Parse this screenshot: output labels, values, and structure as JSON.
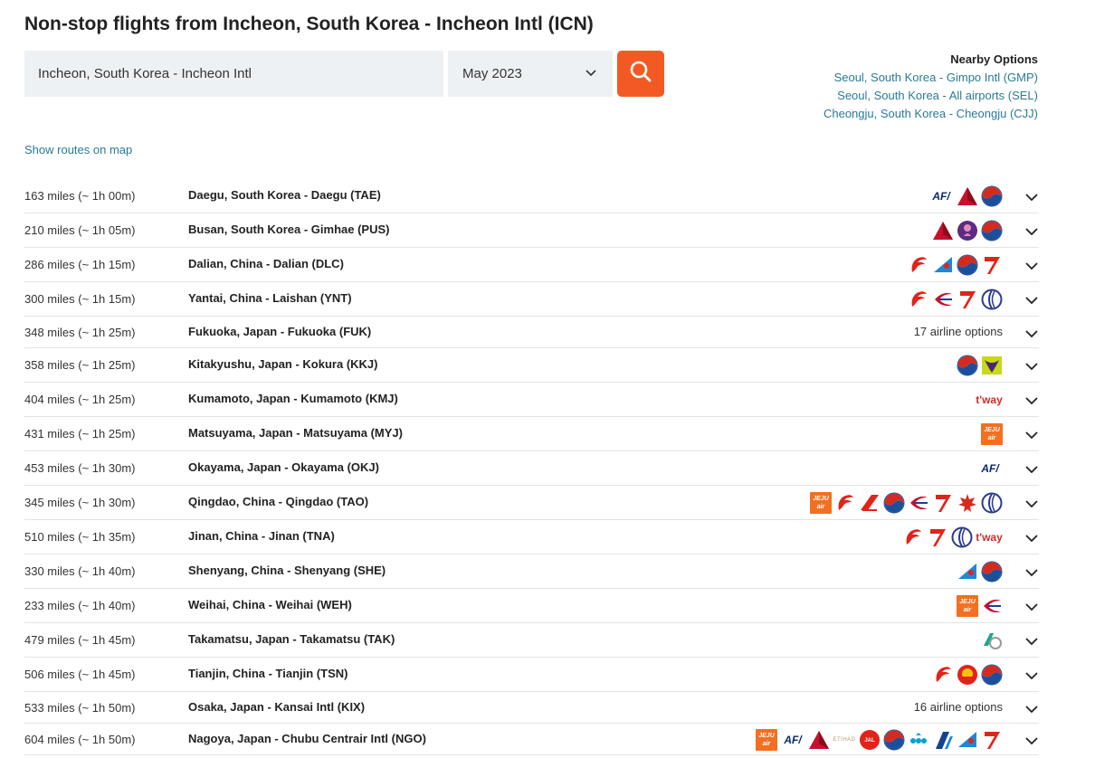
{
  "page": {
    "title": "Non-stop flights from Incheon, South Korea - Incheon Intl (ICN)"
  },
  "search": {
    "origin_value": "Incheon, South Korea - Incheon Intl",
    "month_value": "May 2023"
  },
  "nearby": {
    "heading": "Nearby Options",
    "links": [
      "Seoul, South Korea - Gimpo Intl (GMP)",
      "Seoul, South Korea - All airports (SEL)",
      "Cheongju, South Korea - Cheongju (CJJ)"
    ]
  },
  "map_link": "Show routes on map",
  "colors": {
    "accent": "#f35a23",
    "link": "#2a7a94",
    "input_bg": "#eef1f3"
  },
  "routes": [
    {
      "distance": "163 miles (~ 1h 00m)",
      "destination": "Daegu, South Korea - Daegu (TAE)",
      "airlines": [
        "airfrance-icon",
        "delta-icon",
        "koreanair-icon"
      ],
      "options_text": ""
    },
    {
      "distance": "210 miles (~ 1h 05m)",
      "destination": "Busan, South Korea - Gimhae (PUS)",
      "airlines": [
        "delta-icon",
        "hawaiian-icon",
        "koreanair-icon"
      ],
      "options_text": ""
    },
    {
      "distance": "286 miles (~ 1h 15m)",
      "destination": "Dalian, China - Dalian (DLC)",
      "airlines": [
        "airchina-icon",
        "chinasouthern-icon",
        "koreanair-icon",
        "asiana-icon"
      ],
      "options_text": ""
    },
    {
      "distance": "300 miles (~ 1h 15m)",
      "destination": "Yantai, China - Laishan (YNT)",
      "airlines": [
        "airchina-icon",
        "chinaeastern-icon",
        "asiana-icon",
        "shandong-icon"
      ],
      "options_text": ""
    },
    {
      "distance": "348 miles (~ 1h 25m)",
      "destination": "Fukuoka, Japan - Fukuoka (FUK)",
      "airlines": [],
      "options_text": "17 airline options"
    },
    {
      "distance": "358 miles (~ 1h 25m)",
      "destination": "Kitakyushu, Japan - Kokura (KKJ)",
      "airlines": [
        "koreanair-icon",
        "starflyer-icon"
      ],
      "options_text": ""
    },
    {
      "distance": "404 miles (~ 1h 25m)",
      "destination": "Kumamoto, Japan - Kumamoto (KMJ)",
      "airlines": [
        "tway-icon"
      ],
      "options_text": ""
    },
    {
      "distance": "431 miles (~ 1h 25m)",
      "destination": "Matsuyama, Japan - Matsuyama (MYJ)",
      "airlines": [
        "jejuair-icon"
      ],
      "options_text": ""
    },
    {
      "distance": "453 miles (~ 1h 30m)",
      "destination": "Okayama, Japan - Okayama (OKJ)",
      "airlines": [
        "airfrance-icon"
      ],
      "options_text": ""
    },
    {
      "distance": "345 miles (~ 1h 30m)",
      "destination": "Qingdao, China - Qingdao (TAO)",
      "airlines": [
        "jejuair-icon",
        "airchina-icon",
        "qingdao-icon",
        "koreanair-icon",
        "chinaeastern-icon",
        "asiana-icon",
        "airCanada-icon",
        "shandong-icon"
      ],
      "options_text": ""
    },
    {
      "distance": "510 miles (~ 1h 35m)",
      "destination": "Jinan, China - Jinan (TNA)",
      "airlines": [
        "airchina-icon",
        "asiana-icon",
        "shandong-icon",
        "tway-icon"
      ],
      "options_text": ""
    },
    {
      "distance": "330 miles (~ 1h 40m)",
      "destination": "Shenyang, China - Shenyang (SHE)",
      "airlines": [
        "chinasouthern-icon",
        "koreanair-icon"
      ],
      "options_text": ""
    },
    {
      "distance": "233 miles (~ 1h 40m)",
      "destination": "Weihai, China - Weihai (WEH)",
      "airlines": [
        "jejuair-icon",
        "chinaeastern-icon"
      ],
      "options_text": ""
    },
    {
      "distance": "479 miles (~ 1h 45m)",
      "destination": "Takamatsu, Japan - Takamatsu (TAK)",
      "airlines": [
        "aerok-icon"
      ],
      "options_text": ""
    },
    {
      "distance": "506 miles (~ 1h 45m)",
      "destination": "Tianjin, China - Tianjin (TSN)",
      "airlines": [
        "airchina-icon",
        "tianjin-icon",
        "koreanair-icon"
      ],
      "options_text": ""
    },
    {
      "distance": "533 miles (~ 1h 50m)",
      "destination": "Osaka, Japan - Kansai Intl (KIX)",
      "airlines": [],
      "options_text": "16 airline options"
    },
    {
      "distance": "604 miles (~ 1h 50m)",
      "destination": "Nagoya, Japan - Chubu Centrair Intl (NGO)",
      "airlines": [
        "jejuair-icon",
        "airfrance-icon",
        "delta-icon",
        "etihad-icon",
        "jal-icon",
        "koreanair-icon",
        "klm-icon",
        "ana-icon",
        "chinasouthern-icon",
        "asiana-icon"
      ],
      "options_text": ""
    }
  ]
}
